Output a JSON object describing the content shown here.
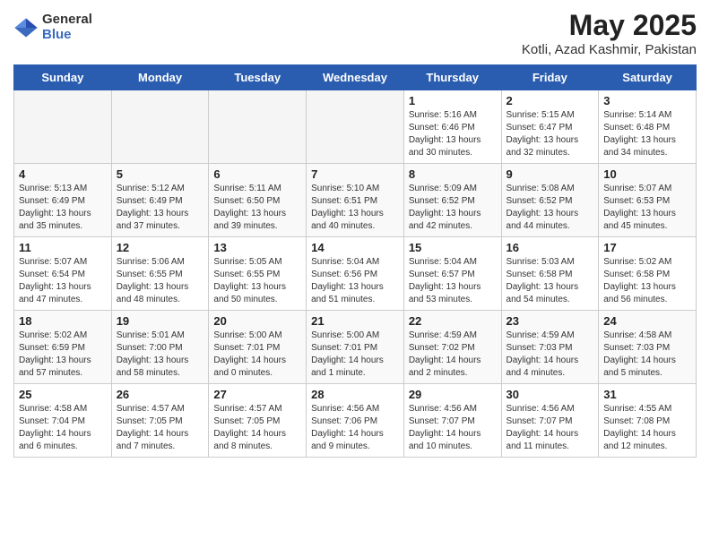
{
  "logo": {
    "general": "General",
    "blue": "Blue"
  },
  "title": "May 2025",
  "subtitle": "Kotli, Azad Kashmir, Pakistan",
  "days_of_week": [
    "Sunday",
    "Monday",
    "Tuesday",
    "Wednesday",
    "Thursday",
    "Friday",
    "Saturday"
  ],
  "weeks": [
    [
      {
        "day": "",
        "info": ""
      },
      {
        "day": "",
        "info": ""
      },
      {
        "day": "",
        "info": ""
      },
      {
        "day": "",
        "info": ""
      },
      {
        "day": "1",
        "info": "Sunrise: 5:16 AM\nSunset: 6:46 PM\nDaylight: 13 hours\nand 30 minutes."
      },
      {
        "day": "2",
        "info": "Sunrise: 5:15 AM\nSunset: 6:47 PM\nDaylight: 13 hours\nand 32 minutes."
      },
      {
        "day": "3",
        "info": "Sunrise: 5:14 AM\nSunset: 6:48 PM\nDaylight: 13 hours\nand 34 minutes."
      }
    ],
    [
      {
        "day": "4",
        "info": "Sunrise: 5:13 AM\nSunset: 6:49 PM\nDaylight: 13 hours\nand 35 minutes."
      },
      {
        "day": "5",
        "info": "Sunrise: 5:12 AM\nSunset: 6:49 PM\nDaylight: 13 hours\nand 37 minutes."
      },
      {
        "day": "6",
        "info": "Sunrise: 5:11 AM\nSunset: 6:50 PM\nDaylight: 13 hours\nand 39 minutes."
      },
      {
        "day": "7",
        "info": "Sunrise: 5:10 AM\nSunset: 6:51 PM\nDaylight: 13 hours\nand 40 minutes."
      },
      {
        "day": "8",
        "info": "Sunrise: 5:09 AM\nSunset: 6:52 PM\nDaylight: 13 hours\nand 42 minutes."
      },
      {
        "day": "9",
        "info": "Sunrise: 5:08 AM\nSunset: 6:52 PM\nDaylight: 13 hours\nand 44 minutes."
      },
      {
        "day": "10",
        "info": "Sunrise: 5:07 AM\nSunset: 6:53 PM\nDaylight: 13 hours\nand 45 minutes."
      }
    ],
    [
      {
        "day": "11",
        "info": "Sunrise: 5:07 AM\nSunset: 6:54 PM\nDaylight: 13 hours\nand 47 minutes."
      },
      {
        "day": "12",
        "info": "Sunrise: 5:06 AM\nSunset: 6:55 PM\nDaylight: 13 hours\nand 48 minutes."
      },
      {
        "day": "13",
        "info": "Sunrise: 5:05 AM\nSunset: 6:55 PM\nDaylight: 13 hours\nand 50 minutes."
      },
      {
        "day": "14",
        "info": "Sunrise: 5:04 AM\nSunset: 6:56 PM\nDaylight: 13 hours\nand 51 minutes."
      },
      {
        "day": "15",
        "info": "Sunrise: 5:04 AM\nSunset: 6:57 PM\nDaylight: 13 hours\nand 53 minutes."
      },
      {
        "day": "16",
        "info": "Sunrise: 5:03 AM\nSunset: 6:58 PM\nDaylight: 13 hours\nand 54 minutes."
      },
      {
        "day": "17",
        "info": "Sunrise: 5:02 AM\nSunset: 6:58 PM\nDaylight: 13 hours\nand 56 minutes."
      }
    ],
    [
      {
        "day": "18",
        "info": "Sunrise: 5:02 AM\nSunset: 6:59 PM\nDaylight: 13 hours\nand 57 minutes."
      },
      {
        "day": "19",
        "info": "Sunrise: 5:01 AM\nSunset: 7:00 PM\nDaylight: 13 hours\nand 58 minutes."
      },
      {
        "day": "20",
        "info": "Sunrise: 5:00 AM\nSunset: 7:01 PM\nDaylight: 14 hours\nand 0 minutes."
      },
      {
        "day": "21",
        "info": "Sunrise: 5:00 AM\nSunset: 7:01 PM\nDaylight: 14 hours\nand 1 minute."
      },
      {
        "day": "22",
        "info": "Sunrise: 4:59 AM\nSunset: 7:02 PM\nDaylight: 14 hours\nand 2 minutes."
      },
      {
        "day": "23",
        "info": "Sunrise: 4:59 AM\nSunset: 7:03 PM\nDaylight: 14 hours\nand 4 minutes."
      },
      {
        "day": "24",
        "info": "Sunrise: 4:58 AM\nSunset: 7:03 PM\nDaylight: 14 hours\nand 5 minutes."
      }
    ],
    [
      {
        "day": "25",
        "info": "Sunrise: 4:58 AM\nSunset: 7:04 PM\nDaylight: 14 hours\nand 6 minutes."
      },
      {
        "day": "26",
        "info": "Sunrise: 4:57 AM\nSunset: 7:05 PM\nDaylight: 14 hours\nand 7 minutes."
      },
      {
        "day": "27",
        "info": "Sunrise: 4:57 AM\nSunset: 7:05 PM\nDaylight: 14 hours\nand 8 minutes."
      },
      {
        "day": "28",
        "info": "Sunrise: 4:56 AM\nSunset: 7:06 PM\nDaylight: 14 hours\nand 9 minutes."
      },
      {
        "day": "29",
        "info": "Sunrise: 4:56 AM\nSunset: 7:07 PM\nDaylight: 14 hours\nand 10 minutes."
      },
      {
        "day": "30",
        "info": "Sunrise: 4:56 AM\nSunset: 7:07 PM\nDaylight: 14 hours\nand 11 minutes."
      },
      {
        "day": "31",
        "info": "Sunrise: 4:55 AM\nSunset: 7:08 PM\nDaylight: 14 hours\nand 12 minutes."
      }
    ]
  ]
}
